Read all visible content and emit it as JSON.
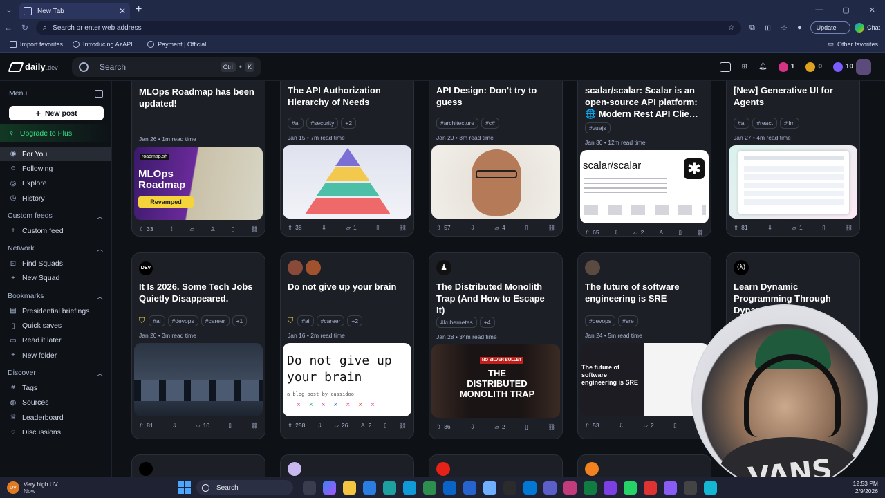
{
  "browser": {
    "tab_title": "New Tab",
    "address_placeholder": "Search or enter web address",
    "update_label": "Update",
    "chat_label": "Chat",
    "favorites": [
      "Import favorites",
      "Introducing AzAPI...",
      "Payment | Official..."
    ],
    "other_favorites": "Other favorites"
  },
  "header": {
    "logo_main": "daily",
    "logo_suffix": ".dev",
    "search_placeholder": "Search",
    "shortcut_ctrl": "Ctrl",
    "shortcut_plus": "+",
    "shortcut_key": "K",
    "streak": "1",
    "gems": "0",
    "reputation": "10"
  },
  "sidebar": {
    "menu_label": "Menu",
    "new_post": "New post",
    "upgrade": "Upgrade to Plus",
    "main_items": [
      "For You",
      "Following",
      "Explore",
      "History"
    ],
    "custom_feeds_title": "Custom feeds",
    "custom_feeds_items": [
      "Custom feed"
    ],
    "network_title": "Network",
    "network_items": [
      "Find Squads",
      "New Squad"
    ],
    "bookmarks_title": "Bookmarks",
    "bookmarks_items": [
      "Presidential briefings",
      "Quick saves",
      "Read it later",
      "New folder"
    ],
    "discover_title": "Discover",
    "discover_items": [
      "Tags",
      "Sources",
      "Leaderboard",
      "Discussions"
    ]
  },
  "cards_row1": [
    {
      "title": "MLOps Roadmap has been updated!",
      "tags": [],
      "meta": "Jan 26 • 1m read time",
      "upvotes": "33",
      "comments": "",
      "thumb_label": "MLOps Roadmap",
      "thumb_badge": "Revamped",
      "thumb_brand": "roadmap.sh"
    },
    {
      "title": "The API Authorization Hierarchy of Needs",
      "tags": [
        "#ai",
        "#security",
        "+2"
      ],
      "meta": "Jan 15 • 7m read time",
      "upvotes": "38",
      "comments": "1"
    },
    {
      "title": "API Design: Don't try to guess",
      "tags": [
        "#architecture",
        "#c#"
      ],
      "meta": "Jan 29 • 3m read time",
      "upvotes": "57",
      "comments": "4"
    },
    {
      "title": "scalar/scalar: Scalar is an open-source API platform: 🌐 Modern Rest API Clie…",
      "tags": [
        "#vuejs"
      ],
      "meta": "Jan 30 • 12m read time",
      "upvotes": "65",
      "comments": "2",
      "thumb_label": "scalar/scalar"
    },
    {
      "title": "[New] Generative UI for Agents",
      "tags": [
        "#ai",
        "#react",
        "#llm"
      ],
      "meta": "Jan 27 • 4m read time",
      "upvotes": "81",
      "comments": "1"
    }
  ],
  "cards_row2": [
    {
      "source": "DEV",
      "title": "It Is 2026. Some Tech Jobs Quietly Disappeared.",
      "tags": [
        "#ai",
        "#devops",
        "#career",
        "+1"
      ],
      "meta": "Jan 20 • 3m read time",
      "upvotes": "81",
      "comments": "10"
    },
    {
      "title": "Do not give up your brain",
      "tags": [
        "#ai",
        "#career",
        "+2"
      ],
      "meta": "Jan 16 • 2m read time",
      "upvotes": "258",
      "comments": "26",
      "awards": "2",
      "thumb_text": "Do not give up your brain",
      "thumb_sub": "a blog post by cassidoo"
    },
    {
      "title": "The Distributed Monolith Trap (And How to Escape It)",
      "tags": [
        "#kubernetes",
        "+4"
      ],
      "meta": "Jan 28 • 34m read time",
      "upvotes": "36",
      "comments": "2",
      "thumb_badge": "NO SILVER BULLET",
      "thumb_text": "THE DISTRIBUTED MONOLITH TRAP"
    },
    {
      "title": "The future of software engineering is SRE",
      "tags": [
        "#devops",
        "#sre"
      ],
      "meta": "Jan 24 • 5m read time",
      "upvotes": "53",
      "comments": "2",
      "thumb_text": "The future of software engineering is SRE"
    },
    {
      "title": "Learn Dynamic Programming Through Dynami…",
      "tags": [],
      "meta": "",
      "upvotes": "",
      "comments": ""
    }
  ],
  "taskbar": {
    "weather_title": "Very high UV",
    "weather_sub": "Now",
    "search": "Search",
    "time": "12:53 PM",
    "date": "2/9/2026"
  },
  "webcam": {
    "shirt_text": "VANS"
  }
}
